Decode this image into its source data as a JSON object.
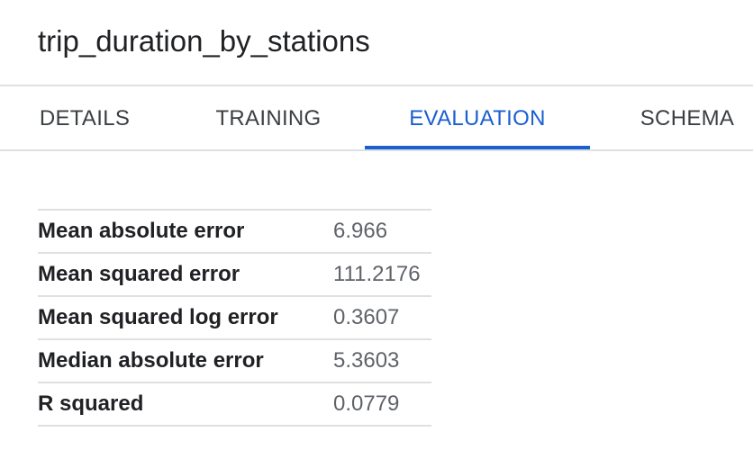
{
  "model": {
    "title": "trip_duration_by_stations"
  },
  "tabs": [
    {
      "label": "DETAILS",
      "active": false
    },
    {
      "label": "TRAINING",
      "active": false
    },
    {
      "label": "EVALUATION",
      "active": true
    },
    {
      "label": "SCHEMA",
      "active": false
    }
  ],
  "colors": {
    "accent": "#1a5fd0",
    "divider": "#e0e0e0",
    "text_primary": "#202124",
    "text_secondary": "#5f6368"
  },
  "evaluation": {
    "metrics": [
      {
        "label": "Mean absolute error",
        "value": "6.966"
      },
      {
        "label": "Mean squared error",
        "value": "111.2176"
      },
      {
        "label": "Mean squared log error",
        "value": "0.3607"
      },
      {
        "label": "Median absolute error",
        "value": "5.3603"
      },
      {
        "label": "R squared",
        "value": "0.0779"
      }
    ]
  }
}
